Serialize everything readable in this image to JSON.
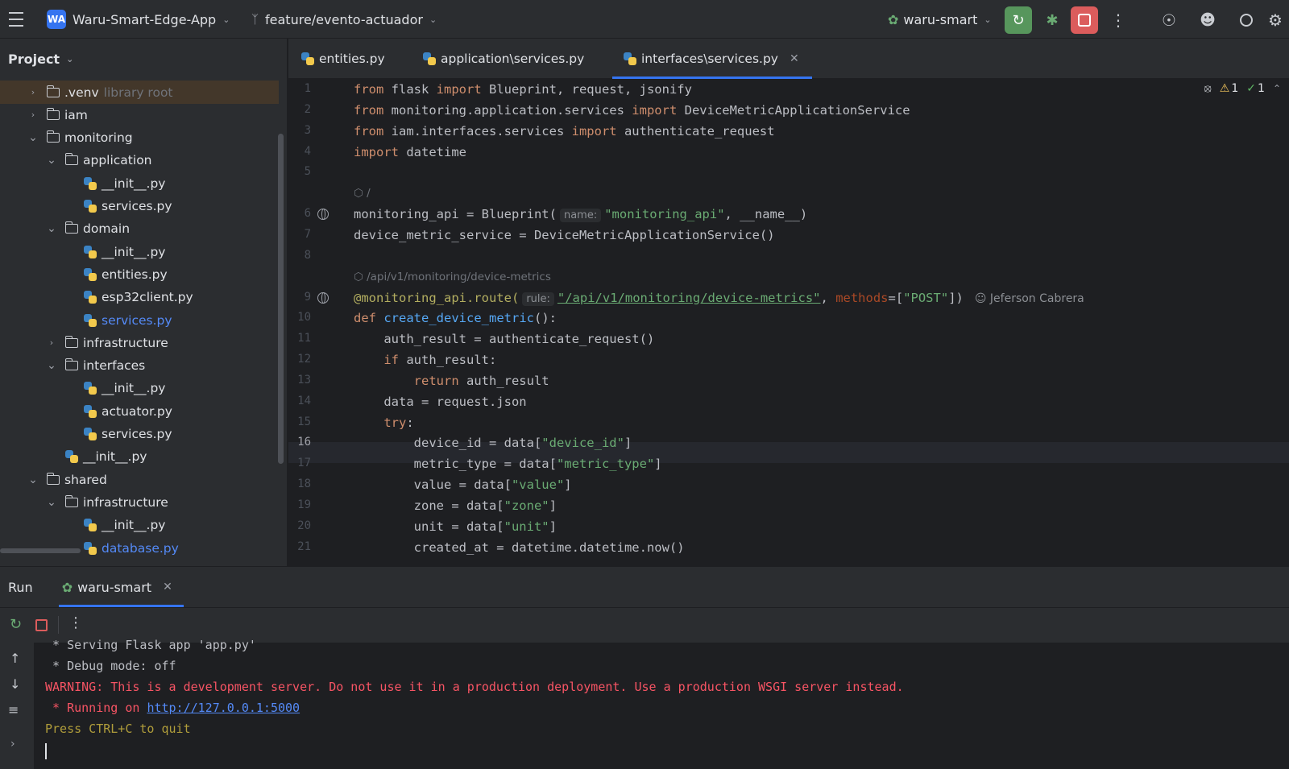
{
  "titlebar": {
    "project_badge": "WA",
    "project_name": "Waru-Smart-Edge-App",
    "branch": "feature/evento-actuador",
    "run_config": "waru-smart"
  },
  "colors": {
    "accent": "#3574f0",
    "run_green": "#57965c",
    "stop_red": "#db5c5c",
    "selection": "#43372a"
  },
  "project": {
    "header": "Project",
    "tree": [
      {
        "label": ".venv",
        "suffix": "library root",
        "kind": "folder",
        "depth": 1,
        "expanded": false,
        "selected": true
      },
      {
        "label": "iam",
        "kind": "folder",
        "depth": 1,
        "expanded": false
      },
      {
        "label": "monitoring",
        "kind": "folder",
        "depth": 1,
        "expanded": true
      },
      {
        "label": "application",
        "kind": "folder",
        "depth": 2,
        "expanded": true
      },
      {
        "label": "__init__.py",
        "kind": "py",
        "depth": 3
      },
      {
        "label": "services.py",
        "kind": "py",
        "depth": 3
      },
      {
        "label": "domain",
        "kind": "folder",
        "depth": 2,
        "expanded": true
      },
      {
        "label": "__init__.py",
        "kind": "py",
        "depth": 3
      },
      {
        "label": "entities.py",
        "kind": "py",
        "depth": 3
      },
      {
        "label": "esp32client.py",
        "kind": "py",
        "depth": 3
      },
      {
        "label": "services.py",
        "kind": "py",
        "depth": 3,
        "highlight": true
      },
      {
        "label": "infrastructure",
        "kind": "folder",
        "depth": 2,
        "expanded": false
      },
      {
        "label": "interfaces",
        "kind": "folder",
        "depth": 2,
        "expanded": true
      },
      {
        "label": "__init__.py",
        "kind": "py",
        "depth": 3
      },
      {
        "label": "actuator.py",
        "kind": "py",
        "depth": 3
      },
      {
        "label": "services.py",
        "kind": "py",
        "depth": 3
      },
      {
        "label": "__init__.py",
        "kind": "py",
        "depth": 2
      },
      {
        "label": "shared",
        "kind": "folder",
        "depth": 1,
        "expanded": true
      },
      {
        "label": "infrastructure",
        "kind": "folder",
        "depth": 2,
        "expanded": true
      },
      {
        "label": "__init__.py",
        "kind": "py",
        "depth": 3
      },
      {
        "label": "database.py",
        "kind": "py",
        "depth": 3,
        "highlight": true
      }
    ]
  },
  "tabs": [
    {
      "label": "entities.py"
    },
    {
      "label": "application\\services.py"
    },
    {
      "label": "interfaces\\services.py",
      "active": true
    }
  ],
  "editor": {
    "inspections": {
      "warnings": "1",
      "weak_warnings": "1"
    },
    "current_line": "16",
    "endpoint_hints": [
      "/",
      "/api/v1/monitoring/device-metrics"
    ],
    "author": "Jeferson Cabrera",
    "lines": [
      {
        "n": "1",
        "html": "<span class='kw'>from</span> flask <span class='kw'>import</span> Blueprint, request, jsonify"
      },
      {
        "n": "2",
        "html": "<span class='kw'>from</span> monitoring.application.services <span class='kw'>import</span> DeviceMetricApplicationService"
      },
      {
        "n": "3",
        "html": "<span class='kw'>from</span> iam.interfaces.services <span class='kw'>import</span> authenticate_request"
      },
      {
        "n": "4",
        "html": "<span class='kw'>import</span> datetime"
      },
      {
        "n": "5",
        "html": ""
      },
      {
        "n": "6",
        "html": "monitoring_api = Blueprint(<span class='hint'>name:</span><span class='str'>\"monitoring_api\"</span>, __name__)",
        "globe": true
      },
      {
        "n": "7",
        "html": "device_metric_service = DeviceMetricApplicationService()"
      },
      {
        "n": "8",
        "html": ""
      },
      {
        "n": "9",
        "html": "<span class='deco'>@monitoring_api.route(</span><span class='hint'>rule:</span><span class='str' style='text-decoration:underline'>\"/api/v1/monitoring/device-metrics\"</span>, <span class='prm'>methods</span>=[<span class='str'>\"POST\"</span>])",
        "globe": true,
        "author": true
      },
      {
        "n": "10",
        "html": "<span class='kw'>def</span> <span class='fn'>create_device_metric</span>():"
      },
      {
        "n": "11",
        "html": "    auth_result = authenticate_request()"
      },
      {
        "n": "12",
        "html": "    <span class='kw'>if</span> auth_result:"
      },
      {
        "n": "13",
        "html": "        <span class='kw'>return</span> auth_result"
      },
      {
        "n": "14",
        "html": "    data = request.json"
      },
      {
        "n": "15",
        "html": "    <span class='kw'>try</span>:"
      },
      {
        "n": "16",
        "html": "        device_id = data[<span class='str'>\"device_id\"</span>]"
      },
      {
        "n": "17",
        "html": "        metric_type = data[<span class='str'>\"metric_type\"</span>]"
      },
      {
        "n": "18",
        "html": "        value = data[<span class='str'>\"value\"</span>]"
      },
      {
        "n": "19",
        "html": "        zone = data[<span class='str'>\"zone\"</span>]"
      },
      {
        "n": "20",
        "html": "        unit = data[<span class='str'>\"unit\"</span>]"
      },
      {
        "n": "21",
        "html": "        created_at = datetime.datetime.now()"
      }
    ]
  },
  "run": {
    "title": "Run",
    "tab": "waru-smart",
    "console": [
      {
        "cls": "white",
        "text": " * Serving Flask app 'app.py'"
      },
      {
        "cls": "white",
        "text": " * Debug mode: off"
      },
      {
        "cls": "red",
        "text": "WARNING: This is a development server. Do not use it in a production deployment. Use a production WSGI server instead."
      },
      {
        "cls": "red",
        "text": " * Running on ",
        "link": "http://127.0.0.1:5000"
      },
      {
        "cls": "yellow",
        "text": "Press CTRL+C to quit"
      }
    ]
  }
}
